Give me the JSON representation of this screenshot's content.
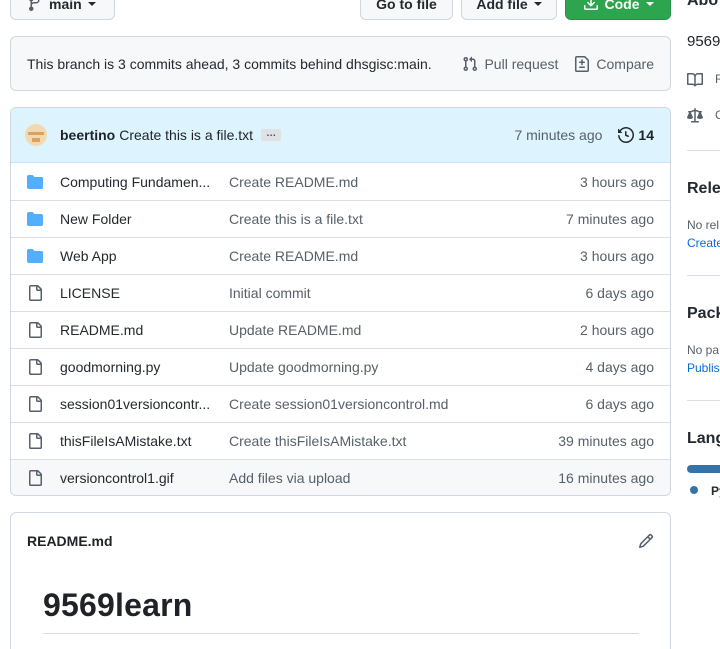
{
  "toolbar": {
    "branch_label": "main",
    "goto_file_label": "Go to file",
    "add_file_label": "Add file",
    "code_label": "Code"
  },
  "ahead_behind": {
    "text": "This branch is 3 commits ahead, 3 commits behind dhsgisc:main.",
    "pull_request_label": "Pull request",
    "compare_label": "Compare"
  },
  "latest_commit": {
    "user": "beertino",
    "message": "Create this is a file.txt",
    "ellipsis": "…",
    "time": "7 minutes ago",
    "commit_count": "14"
  },
  "files": [
    {
      "type": "folder",
      "name": "Computing Fundamen...",
      "message": "Create README.md",
      "age": "3 hours ago"
    },
    {
      "type": "folder",
      "name": "New Folder",
      "message": "Create this is a file.txt",
      "age": "7 minutes ago"
    },
    {
      "type": "folder",
      "name": "Web App",
      "message": "Create README.md",
      "age": "3 hours ago"
    },
    {
      "type": "file",
      "name": "LICENSE",
      "message": "Initial commit",
      "age": "6 days ago"
    },
    {
      "type": "file",
      "name": "README.md",
      "message": "Update README.md",
      "age": "2 hours ago"
    },
    {
      "type": "file",
      "name": "goodmorning.py",
      "message": "Update goodmorning.py",
      "age": "4 days ago"
    },
    {
      "type": "file",
      "name": "session01versioncontr...",
      "message": "Create session01versioncontrol.md",
      "age": "6 days ago"
    },
    {
      "type": "file",
      "name": "thisFileIsAMistake.txt",
      "message": "Create thisFileIsAMistake.txt",
      "age": "39 minutes ago"
    },
    {
      "type": "file",
      "name": "versioncontrol1.gif",
      "message": "Add files via upload",
      "age": "16 minutes ago"
    }
  ],
  "readme": {
    "filename": "README.md",
    "heading": "9569learn"
  },
  "sidebar": {
    "about_heading": "Abo",
    "description": "9569",
    "readme_link": "R",
    "license_link": "C",
    "releases_heading": "Rele",
    "releases_note": "No rel",
    "releases_link": "Create",
    "packages_heading": "Pack",
    "packages_note": "No pa",
    "packages_link": "Publis",
    "languages_heading": "Lang",
    "language_name": "Py"
  },
  "colors": {
    "code_button": "#2da44e",
    "commit_header_bg": "#ddf4ff",
    "folder_icon": "#54aeff",
    "link": "#0969da",
    "python": "#3572a5"
  }
}
